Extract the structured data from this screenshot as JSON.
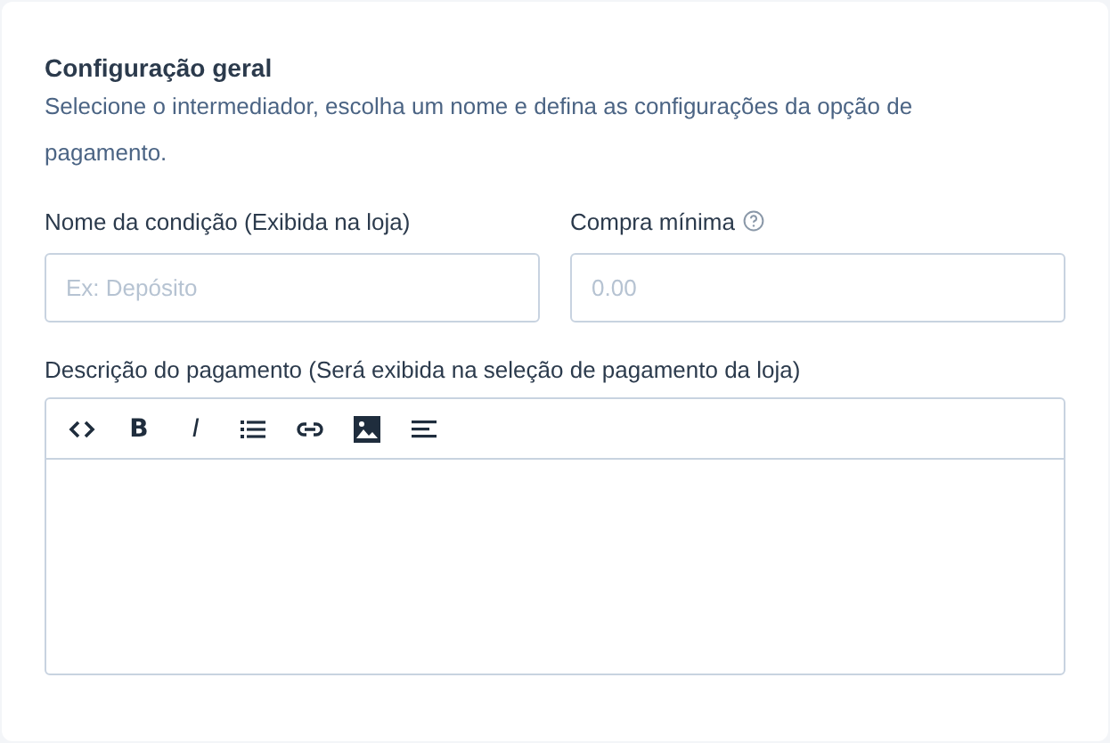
{
  "section": {
    "title": "Configuração geral",
    "description": "Selecione o intermediador, escolha um nome e defina as configurações da opção de pagamento."
  },
  "fields": [
    {
      "label": "Nome da condição (Exibida na loja)",
      "placeholder": "Ex: Depósito",
      "help": false
    },
    {
      "label": "Compra mínima",
      "placeholder": "0.00",
      "help": true
    }
  ],
  "editor": {
    "label": "Descrição do pagamento (Será exibida na seleção de pagamento da loja)",
    "toolbar": [
      {
        "kind": "code"
      },
      {
        "kind": "bold",
        "label": "B"
      },
      {
        "kind": "italic",
        "label": "I"
      },
      {
        "kind": "list"
      },
      {
        "kind": "link"
      },
      {
        "kind": "image"
      },
      {
        "kind": "align"
      }
    ]
  }
}
